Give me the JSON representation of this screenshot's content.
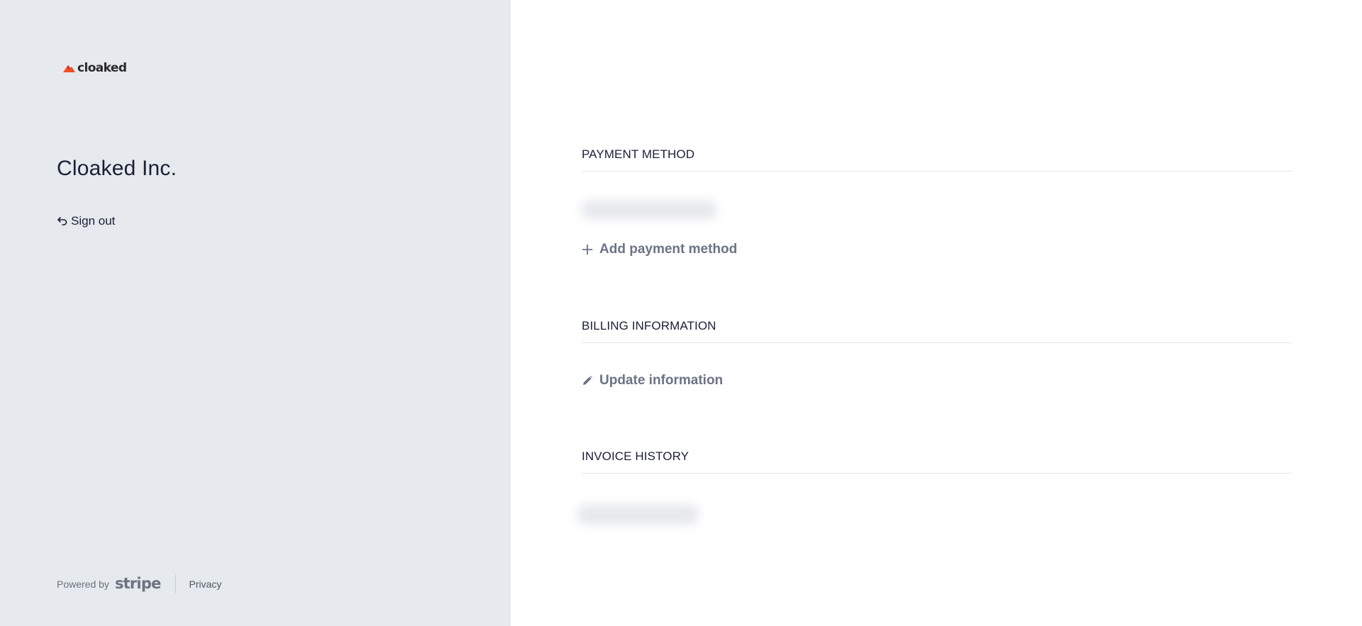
{
  "sidebar": {
    "logo_text": "cloaked",
    "logo_icon": "cloaked-flame-icon",
    "company_name": "Cloaked Inc.",
    "sign_out_label": "Sign out",
    "sign_out_icon": "sign-out-icon",
    "footer": {
      "powered_by": "Powered by",
      "stripe_label": "stripe",
      "privacy_label": "Privacy"
    }
  },
  "main": {
    "payment_method": {
      "title": "PAYMENT METHOD",
      "add_label": "Add payment method",
      "add_icon": "plus-icon"
    },
    "billing_information": {
      "title": "BILLING INFORMATION",
      "update_label": "Update information",
      "update_icon": "pencil-icon"
    },
    "invoice_history": {
      "title": "INVOICE HISTORY"
    }
  },
  "colors": {
    "sidebar_bg": "#e6e9ed",
    "brand_orange": "#f04e23",
    "text_dark": "#1a1f36",
    "action_gray": "#6b7385"
  }
}
